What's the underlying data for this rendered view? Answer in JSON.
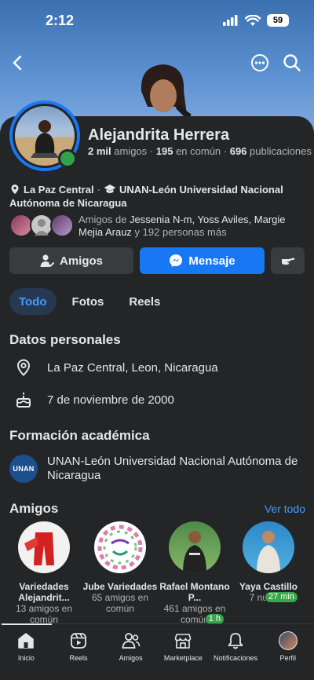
{
  "status_bar": {
    "time": "2:12",
    "battery": "59"
  },
  "profile": {
    "name": "Alejandrita Herrera",
    "stats": {
      "friends_count": "2 mil",
      "friends_label": "amigos",
      "common_count": "195",
      "common_label": "en común",
      "posts_count": "696",
      "posts_label": "publicaciones"
    },
    "location": "La Paz Central",
    "university": "UNAN-León Universidad Nacional Autónoma de Nicaragua",
    "mutual_prefix": "Amigos de",
    "mutual_names": "Jessenia N-m, Yoss Aviles, Margie Mejia Arauz",
    "mutual_suffix": "y 192 personas más"
  },
  "actions": {
    "friends_label": "Amigos",
    "message_label": "Mensaje"
  },
  "tabs": [
    {
      "label": "Todo",
      "active": true
    },
    {
      "label": "Fotos"
    },
    {
      "label": "Reels"
    }
  ],
  "personal": {
    "title": "Datos personales",
    "location": "La Paz Central, Leon, Nicaragua",
    "birthday": "7 de noviembre de 2000"
  },
  "education": {
    "title": "Formación académica",
    "school": "UNAN-León Universidad Nacional Autónoma de Nicaragua",
    "logo_text": "UNAN"
  },
  "friends": {
    "title": "Amigos",
    "see_all": "Ver todo",
    "items": [
      {
        "name": "Variedades Alejandrit...",
        "sub": "13 amigos en común",
        "badge": ""
      },
      {
        "name": "Jube Variedades",
        "sub": "65 amigos en común",
        "badge": ""
      },
      {
        "name": "Rafael Montano P...",
        "sub": "461 amigos en común",
        "badge": "1 h"
      },
      {
        "name": "Yaya Castillo",
        "sub": "7 nuevos",
        "badge": "27 min"
      }
    ]
  },
  "nav": [
    {
      "label": "Inicio"
    },
    {
      "label": "Reels"
    },
    {
      "label": "Amigos"
    },
    {
      "label": "Marketplace"
    },
    {
      "label": "Notificaciones"
    },
    {
      "label": "Perfil"
    }
  ],
  "colors": {
    "accent": "#1877f2",
    "link": "#4599ff",
    "background": "#242526",
    "online": "#31a24c"
  }
}
